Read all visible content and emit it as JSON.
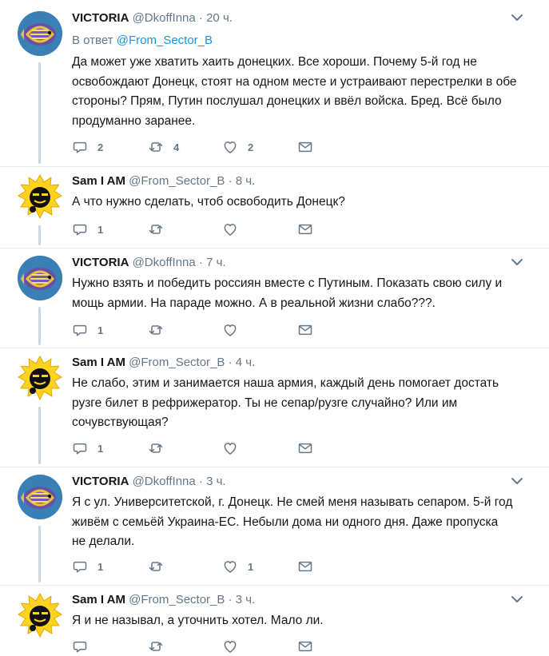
{
  "tweets": [
    {
      "author": "victoria",
      "name": "VICTORIA",
      "handle": "@DkoffInna",
      "dot": "·",
      "time": "20 ч.",
      "reply_prefix": "В ответ",
      "reply_handle": "@From_Sector_B",
      "lines": [
        "Да может уже хватить хаить донецких. Все хороши. Почему 5-й год не",
        "освобождают Донецк, стоят на одном месте и устраивают перестрелки в обе",
        "стороны? Прям,  Путин послушал донецких и ввёл войска. Бред. Всё было",
        "продуманно заранее."
      ],
      "replies": "2",
      "retweets": "4",
      "likes": "2"
    },
    {
      "author": "sam",
      "name": "Sam I AM",
      "handle": "@From_Sector_B",
      "dot": "·",
      "time": "8 ч.",
      "lines": [
        "А что нужно сделать, чтоб освободить Донецк?"
      ],
      "replies": "1",
      "retweets": "",
      "likes": ""
    },
    {
      "author": "victoria",
      "name": "VICTORIA",
      "handle": "@DkoffInna",
      "dot": "·",
      "time": "7 ч.",
      "lines": [
        "Нужно взять и победить россиян вместе с Путиным. Показать свою силу и",
        "мощь армии. На параде можно. А в реальной жизни слабо???."
      ],
      "replies": "1",
      "retweets": "",
      "likes": ""
    },
    {
      "author": "sam",
      "name": "Sam I AM",
      "handle": "@From_Sector_B",
      "dot": "·",
      "time": "4 ч.",
      "lines": [
        "Не слабо, этим и занимается наша армия, каждый день помогает достать",
        "рузге билет в рефрижератор. Ты не сепар/рузге случайно? Или им",
        "сочувствующая?"
      ],
      "replies": "1",
      "retweets": "",
      "likes": ""
    },
    {
      "author": "victoria",
      "name": "VICTORIA",
      "handle": "@DkoffInna",
      "dot": "·",
      "time": "3 ч.",
      "lines": [
        "Я с ул. Университетской, г. Донецк. Не смей меня называть сепаром. 5-й год",
        "живём с  семьёй Украина-ЕС.  Небыли дома ни одного дня. Даже пропуска",
        "не делали."
      ],
      "replies": "1",
      "retweets": "",
      "likes": "1"
    },
    {
      "author": "sam",
      "name": "Sam I AM",
      "handle": "@From_Sector_B",
      "dot": "·",
      "time": "3 ч.",
      "lines": [
        "Я и не называл, а уточнить хотел. Мало ли."
      ],
      "replies": "",
      "retweets": "",
      "likes": ""
    }
  ],
  "icons": {
    "reply": "reply-icon",
    "retweet": "retweet-icon",
    "like": "heart-icon",
    "dm": "envelope-icon",
    "more": "chevron-down-icon"
  },
  "colors": {
    "text": "#14171a",
    "muted": "#657786",
    "link": "#1b95e0",
    "thread": "#ccd6dd",
    "sam_avatar": "#ffd21f"
  }
}
